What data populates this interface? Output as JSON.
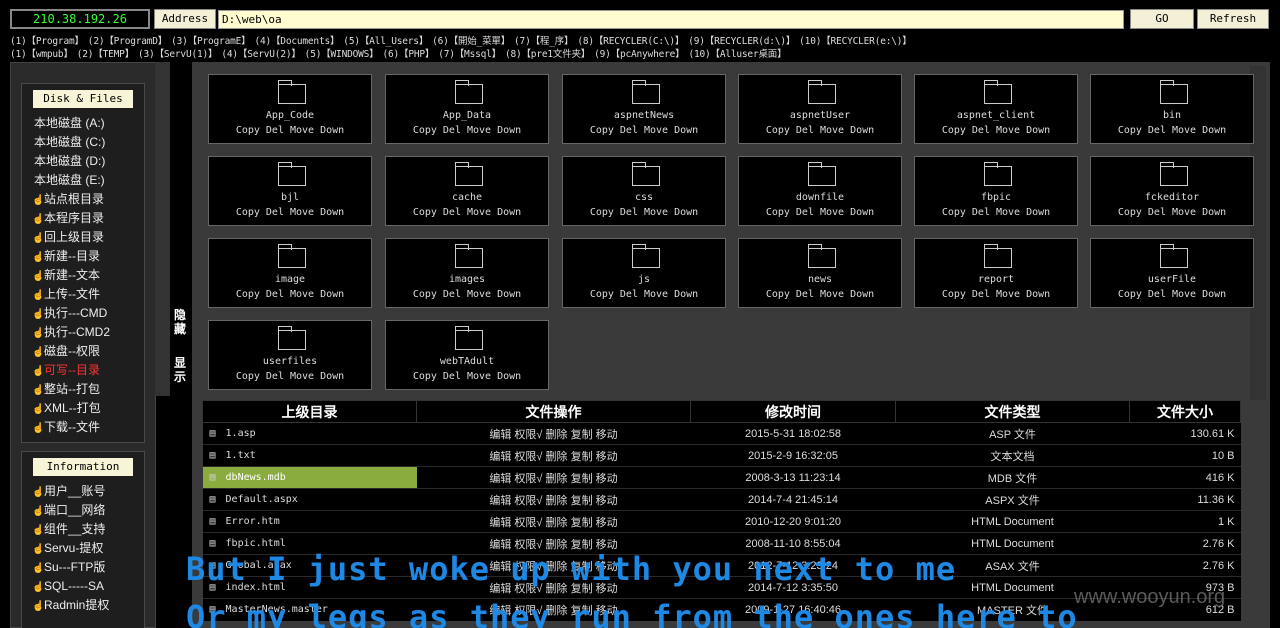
{
  "topbar": {
    "ip": "210.38.192.26",
    "address_label": "Address",
    "address_value": "D:\\web\\oa",
    "go_label": "GO",
    "refresh_label": "Refresh"
  },
  "shortcuts": {
    "row1": [
      "(1)【Program】",
      "(2)【ProgramD】",
      "(3)【ProgramE】",
      "(4)【Documents】",
      "(5)【All_Users】",
      "(6)【開始_菜單】",
      "(7)【程_序】",
      "(8)【RECYCLER(C:\\)】",
      "(9)【RECYCLER(d:\\)】",
      "(10)【RECYCLER(e:\\)】"
    ],
    "row2": [
      "(1)【wmpub】",
      "(2)【TEMP】",
      "(3)【ServU(1)】",
      "(4)【ServU(2)】",
      "(5)【WINDOWS】",
      "(6)【PHP】",
      "(7)【Mssql】",
      "(8)【pre1文件夹】",
      "(9)【pcAnywhere】",
      "(10)【Alluser桌面】"
    ]
  },
  "sidebar": {
    "disk_title": "Disk & Files",
    "disks": [
      "本地磁盘 (A:)",
      "本地磁盘 (C:)",
      "本地磁盘 (D:)",
      "本地磁盘 (E:)"
    ],
    "items": [
      "站点根目录",
      "本程序目录",
      "回上级目录",
      "新建--目录",
      "新建--文本",
      "上传--文件",
      "执行---CMD",
      "执行--CMD2",
      "磁盘--权限",
      "可写--目录",
      "整站--打包",
      "XML--打包",
      "下载--文件"
    ],
    "info_title": "Information",
    "info_items": [
      "用户__账号",
      "端口__网络",
      "组件__支持",
      "Servu-提权",
      "Su---FTP版",
      "SQL-----SA",
      "Radmin提权"
    ]
  },
  "toggle": {
    "hide": "隐藏",
    "show": "显示"
  },
  "folders": {
    "actions": "Copy Del Move Down",
    "names": [
      "App_Code",
      "App_Data",
      "aspnetNews",
      "aspnetUser",
      "aspnet_client",
      "bin",
      "bjl",
      "cache",
      "css",
      "downfile",
      "fbpic",
      "fckeditor",
      "image",
      "images",
      "js",
      "news",
      "report",
      "userFile",
      "userfiles",
      "webTAdult"
    ]
  },
  "table": {
    "headers": [
      "上级目录",
      "文件操作",
      "修改时间",
      "文件类型",
      "文件大小"
    ],
    "ops": "编辑 权限√ 删除 复制 移动",
    "rows": [
      {
        "name": "1.asp",
        "time": "2015-5-31 18:02:58",
        "type": "ASP 文件",
        "size": "130.61 K"
      },
      {
        "name": "1.txt",
        "time": "2015-2-9 16:32:05",
        "type": "文本文档",
        "size": "10 B"
      },
      {
        "name": "dbNews.mdb",
        "time": "2008-3-13 11:23:14",
        "type": "MDB 文件",
        "size": "416 K"
      },
      {
        "name": "Default.aspx",
        "time": "2014-7-4 21:45:14",
        "type": "ASPX 文件",
        "size": "11.36 K"
      },
      {
        "name": "Error.htm",
        "time": "2010-12-20 9:01:20",
        "type": "HTML Document",
        "size": "1 K"
      },
      {
        "name": "fbpic.html",
        "time": "2008-11-10 8:55:04",
        "type": "HTML Document",
        "size": "2.76 K"
      },
      {
        "name": "Global.asax",
        "time": "2012-7-12 3:23:24",
        "type": "ASAX 文件",
        "size": "2.76 K"
      },
      {
        "name": "index.html",
        "time": "2014-7-12 3:35:50",
        "type": "HTML Document",
        "size": "973 B"
      },
      {
        "name": "MasterNews.master",
        "time": "2009-1-27 16:40:46",
        "type": "MASTER 文件",
        "size": "612 B"
      }
    ]
  },
  "subtitle": {
    "line1": "But I just woke up with you next to me",
    "line2": "Or my legs as they run from the ones here to"
  },
  "watermark": "www.wooyun.org"
}
